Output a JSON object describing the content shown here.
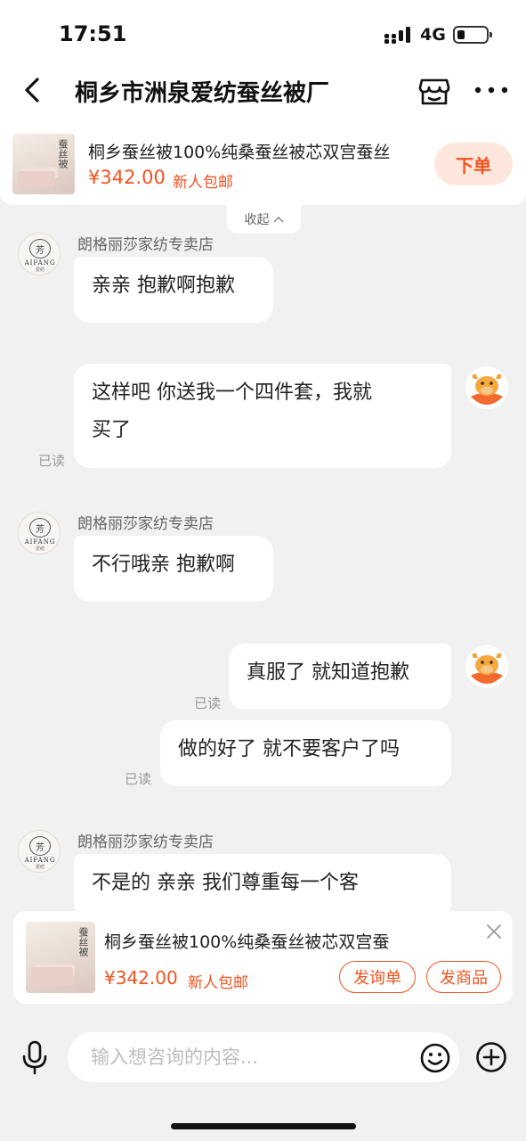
{
  "status_bar": {
    "time": "17:51",
    "network": "4G"
  },
  "nav": {
    "title": "桐乡市洲泉爱纺蚕丝被厂"
  },
  "product_header": {
    "title": "桐乡蚕丝被100%纯桑蚕丝被芯双宫蚕丝",
    "price": "¥342.00",
    "tag": "新人包邮",
    "order_label": "下单",
    "thumb_text": "蚕丝被"
  },
  "collapse_label": "收起",
  "shop_avatar": {
    "mark": "芳",
    "brand": "AIFANG",
    "brand_sub": "爱纺"
  },
  "messages": [
    {
      "side": "in",
      "sender": "朗格丽莎家纺专卖店",
      "text": "亲亲 抱歉啊抱歉"
    },
    {
      "side": "out",
      "lines": [
        "这样吧 你送我一个四件套，我就",
        "买了"
      ],
      "status": "已读"
    },
    {
      "side": "in",
      "sender": "朗格丽莎家纺专卖店",
      "text": "不行哦亲 抱歉啊"
    },
    {
      "side": "out",
      "text": "真服了 就知道抱歉",
      "status": "已读"
    },
    {
      "side": "out",
      "text": "做的好了 就不要客户了吗",
      "status": "已读"
    },
    {
      "side": "in",
      "sender": "朗格丽莎家纺专卖店",
      "text": "不是的 亲亲 我们尊重每一个客"
    }
  ],
  "product_card": {
    "title": "桐乡蚕丝被100%纯桑蚕丝被芯双宫蚕",
    "price": "¥342.00",
    "tag": "新人包邮",
    "inquiry_label": "发询单",
    "send_label": "发商品",
    "thumb_text": "蚕丝被"
  },
  "input": {
    "placeholder": "输入想咨询的内容..."
  },
  "colors": {
    "accent": "#f2531f",
    "accent_soft": "#fde7dc",
    "background": "#f1f1f1"
  }
}
